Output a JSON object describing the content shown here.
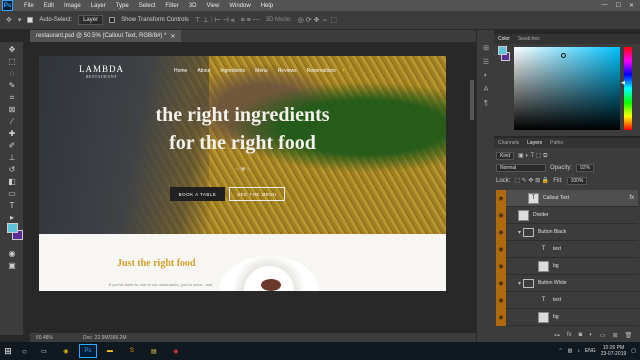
{
  "app": {
    "menu": [
      "File",
      "Edit",
      "Image",
      "Layer",
      "Type",
      "Select",
      "Filter",
      "3D",
      "View",
      "Window",
      "Help"
    ],
    "logo": "Ps"
  },
  "options_bar": {
    "auto_select_label": "Auto-Select:",
    "auto_select_value": "Layer",
    "transform_label": "Show Transform Controls",
    "mode_3d": "3D Mode:"
  },
  "document": {
    "tab_label": "restaurant.psd @ 50.5% (Callout Text, RGB/8#) *",
    "zoom": "50.48%",
    "doc_info": "Doc: 22.9M/366.2M"
  },
  "site": {
    "logo": "LAMBDA",
    "logo_sub": "RESTAURANT",
    "nav": [
      "Home",
      "About",
      "Ingredients",
      "Menu",
      "Reviews",
      "Reservations"
    ],
    "headline_1": "the right ingredients",
    "headline_2": "for the right food",
    "divider": "~ ✾ ~",
    "btn_black": "BOOK A TABLE",
    "btn_white": "SEE THE MENU",
    "lower_title": "Just the right food",
    "lower_text": "If you've been to one of our restaurants, you've seen - and"
  },
  "color_panel": {
    "tabs": [
      "Color",
      "Swatches"
    ],
    "fg_color": "#5fc2d8",
    "bg_color": "#5b2d96"
  },
  "layers_panel": {
    "tabs": [
      "Channels",
      "Layers",
      "Paths"
    ],
    "kind_label": "Kind",
    "blend_mode": "Normal",
    "opacity_label": "Opacity:",
    "opacity_value": "92%",
    "lock_label": "Lock:",
    "fill_label": "Fill:",
    "fill_value": "100%",
    "layers": [
      {
        "name": "Callout Text",
        "type": "text",
        "selected": true,
        "fx": "fx"
      },
      {
        "name": "Divider",
        "type": "shape",
        "selected": false
      },
      {
        "name": "Button Black",
        "type": "group",
        "selected": false
      },
      {
        "name": "text",
        "type": "text",
        "selected": false
      },
      {
        "name": "bg",
        "type": "shape",
        "selected": false
      },
      {
        "name": "Button White",
        "type": "group",
        "selected": false
      },
      {
        "name": "text",
        "type": "text",
        "selected": false
      },
      {
        "name": "bg",
        "type": "shape",
        "selected": false
      }
    ]
  },
  "taskbar": {
    "apps": [
      "chrome",
      "ps",
      "explorer",
      "sublime",
      "fm",
      "chrome2"
    ],
    "time": "10:26 PM",
    "date": "23-07-2019",
    "lang": "ENG"
  }
}
